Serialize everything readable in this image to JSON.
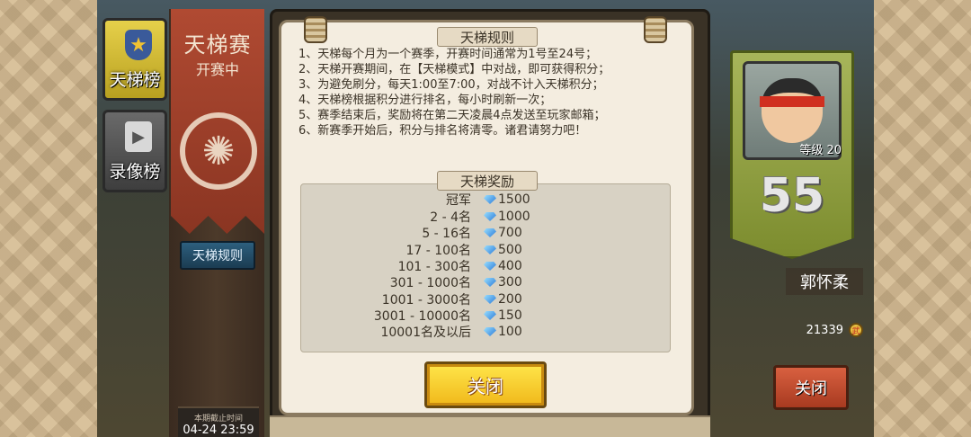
{
  "tabs": [
    {
      "label": "天梯榜",
      "icon": "trophy-icon"
    },
    {
      "label": "录像榜",
      "icon": "video-icon"
    }
  ],
  "banner": {
    "title": "天梯赛",
    "subtitle": "开赛中",
    "rules_button": "天梯规则"
  },
  "deadline": {
    "label": "本期截止时间",
    "value": "04-24 23:59"
  },
  "modal": {
    "rules_title": "天梯规则",
    "rules": [
      "1、天梯每个月为一个赛季，开赛时间通常为1号至24号；",
      "2、天梯开赛期间，在【天梯模式】中对战，即可获得积分；",
      "3、为避免刷分，每天1:00至7:00，对战不计入天梯积分；",
      "4、天梯榜根据积分进行排名，每小时刷新一次；",
      "5、赛季结束后，奖励将在第二天凌晨4点发送至玩家邮箱；",
      "6、新赛季开始后，积分与排名将清零。诸君请努力吧！"
    ],
    "rewards_title": "天梯奖励",
    "rewards": [
      {
        "rank": "冠军",
        "amount": "1500"
      },
      {
        "rank": "2 - 4名",
        "amount": "1000"
      },
      {
        "rank": "5 - 16名",
        "amount": "700"
      },
      {
        "rank": "17 - 100名",
        "amount": "500"
      },
      {
        "rank": "101 - 300名",
        "amount": "400"
      },
      {
        "rank": "301 - 1000名",
        "amount": "300"
      },
      {
        "rank": "1001 - 3000名",
        "amount": "200"
      },
      {
        "rank": "3001 - 10000名",
        "amount": "150"
      },
      {
        "rank": "10001名及以后",
        "amount": "100"
      }
    ],
    "close_label": "关闭"
  },
  "profile": {
    "level": "等级 20",
    "rank": "55",
    "name": "郭怀柔",
    "score": "21339",
    "score_icon": "coin-icon",
    "close_label": "关闭"
  }
}
